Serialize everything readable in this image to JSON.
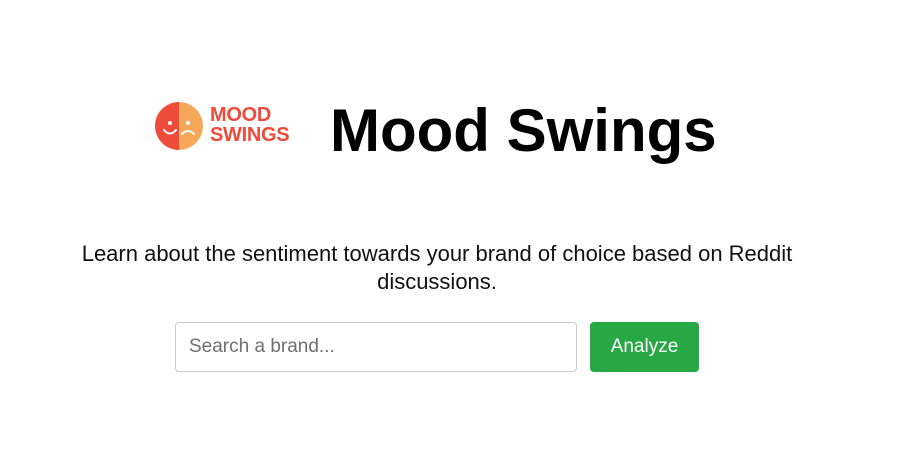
{
  "logo": {
    "line1": "MOOD",
    "line2": "SWINGS",
    "icon": "happy-sad-face-icon",
    "colors": {
      "left": "#ee4b3a",
      "right": "#f5a85a",
      "text": "#ee4b3a"
    }
  },
  "header": {
    "title": "Mood Swings"
  },
  "main": {
    "tagline": "Learn about the sentiment towards your brand of choice based on Reddit discussions."
  },
  "search": {
    "placeholder": "Search a brand...",
    "value": "",
    "button_label": "Analyze",
    "button_color": "#28a745"
  }
}
